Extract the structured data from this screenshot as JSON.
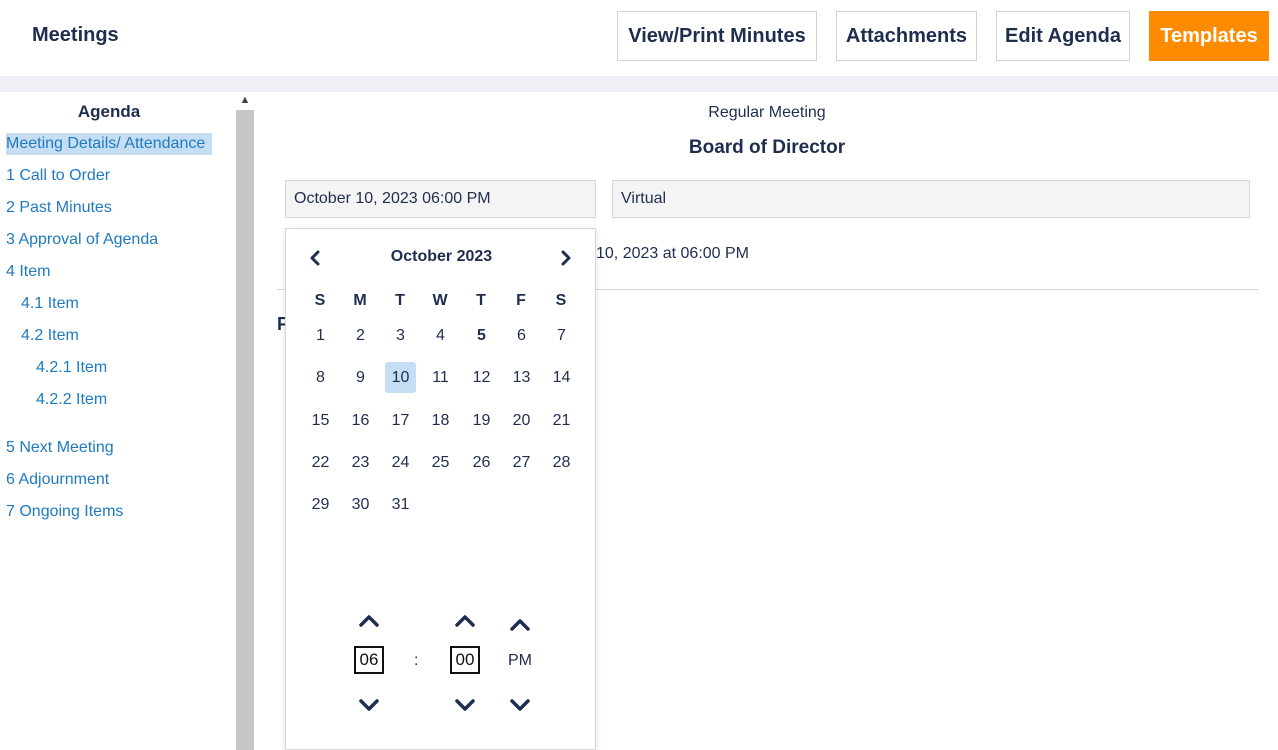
{
  "header": {
    "title": "Meetings",
    "buttons": {
      "view_print": "View/Print Minutes",
      "attachments": "Attachments",
      "edit_agenda": "Edit Agenda",
      "templates": "Templates"
    },
    "accent_color": "#ff8c00"
  },
  "sidebar": {
    "title": "Agenda",
    "items": [
      {
        "label": "Meeting Details/ Attendance"
      },
      {
        "label": "1 Call to Order"
      },
      {
        "label": "2 Past Minutes"
      },
      {
        "label": "3 Approval of Agenda"
      },
      {
        "label": "4 Item"
      },
      {
        "label": "4.1 Item"
      },
      {
        "label": "4.2 Item"
      },
      {
        "label": "4.2.1 Item"
      },
      {
        "label": "4.2.2 Item"
      },
      {
        "label": "5 Next Meeting"
      },
      {
        "label": "6 Adjournment"
      },
      {
        "label": "7 Ongoing Items"
      }
    ]
  },
  "main": {
    "meeting_type": "Regular Meeting",
    "board_name": "Board of Director",
    "date_field": "October 10, 2023 06:00 PM",
    "location_field": "Virtual",
    "behind_text": "10, 2023 at 06:00 PM",
    "behind_letter": "F"
  },
  "picker": {
    "month_label": "October 2023",
    "weekdays": [
      "S",
      "M",
      "T",
      "W",
      "T",
      "F",
      "S"
    ],
    "weeks": [
      [
        "1",
        "2",
        "3",
        "4",
        "5",
        "6",
        "7"
      ],
      [
        "8",
        "9",
        "10",
        "11",
        "12",
        "13",
        "14"
      ],
      [
        "15",
        "16",
        "17",
        "18",
        "19",
        "20",
        "21"
      ],
      [
        "22",
        "23",
        "24",
        "25",
        "26",
        "27",
        "28"
      ],
      [
        "29",
        "30",
        "31",
        "",
        "",
        "",
        ""
      ]
    ],
    "selected_day": "10",
    "today_day": "5",
    "hour": "06",
    "minute": "00",
    "separator": ":",
    "ampm": "PM"
  }
}
